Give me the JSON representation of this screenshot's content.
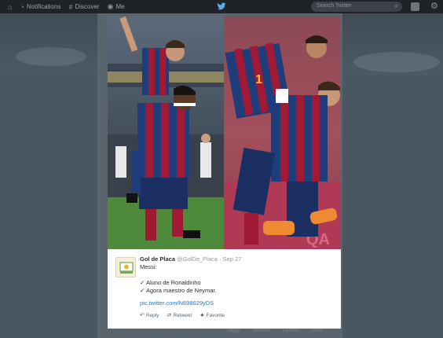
{
  "topbar": {
    "items": [
      {
        "icon": "home-icon",
        "glyph": "⌂",
        "label": ""
      },
      {
        "icon": "bell-icon",
        "glyph": "🔔",
        "label": "Notifications"
      },
      {
        "icon": "hash-icon",
        "glyph": "#",
        "label": "Discover"
      },
      {
        "icon": "person-icon",
        "glyph": "👤",
        "label": "Me"
      }
    ],
    "search_placeholder": "Search Twitter"
  },
  "background": {
    "actions": [
      "Reply",
      "Retweet",
      "Favorite",
      "More"
    ]
  },
  "tweet": {
    "name": "Gol de Placa",
    "handle": "@GolDe_Placa",
    "separator": "·",
    "date": "Sep 27",
    "lines": [
      "Messi:",
      "",
      "✓ Aluno de Ronaldinho",
      "✓ Agora maestro de Neymar."
    ],
    "link": "pic.twitter.com/N698629yDS",
    "actions": [
      {
        "icon": "reply-icon",
        "glyph": "↶",
        "label": "Reply"
      },
      {
        "icon": "retweet-icon",
        "glyph": "⇄",
        "label": "Retweet"
      },
      {
        "icon": "favorite-icon",
        "glyph": "★",
        "label": "Favorite"
      }
    ]
  },
  "colors": {
    "link": "#2b7bb9",
    "barca_blue": "#1f3d7a",
    "barca_red": "#a01935",
    "pitch": "#4f8a3c"
  }
}
